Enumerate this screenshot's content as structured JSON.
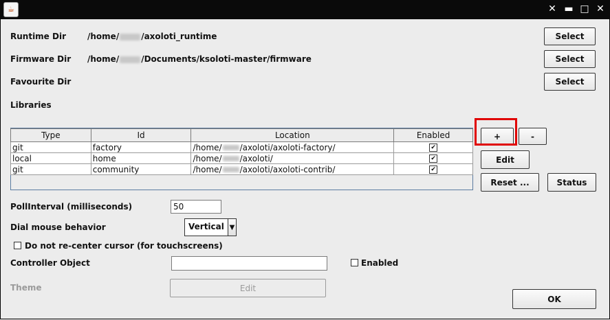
{
  "window": {
    "title": ""
  },
  "window_controls": {
    "close": "✕",
    "minimize": "▬",
    "maximize": "□",
    "restore": "✕"
  },
  "dirs": {
    "runtime": {
      "label": "Runtime Dir",
      "prefix": "/home/",
      "suffix": "/axoloti_runtime",
      "button": "Select"
    },
    "firmware": {
      "label": "Firmware Dir",
      "prefix": "/home/",
      "suffix": "/Documents/ksoloti-master/firmware",
      "button": "Select"
    },
    "favourite": {
      "label": "Favourite Dir",
      "button": "Select"
    }
  },
  "libraries": {
    "label": "Libraries",
    "columns": [
      "Type",
      "Id",
      "Location",
      "Enabled"
    ],
    "rows": [
      {
        "type": "git",
        "id": "factory",
        "loc_prefix": "/home/",
        "loc_suffix": "/axoloti/axoloti-factory/",
        "enabled": "✔"
      },
      {
        "type": "local",
        "id": "home",
        "loc_prefix": "/home/",
        "loc_suffix": "/axoloti/",
        "enabled": "✔"
      },
      {
        "type": "git",
        "id": "community",
        "loc_prefix": "/home/",
        "loc_suffix": "/axoloti/axoloti-contrib/",
        "enabled": "✔"
      }
    ],
    "buttons": {
      "add": "+",
      "remove": "-",
      "edit": "Edit",
      "reset": "Reset ...",
      "status": "Status"
    }
  },
  "poll": {
    "label": "PollInterval (milliseconds)",
    "value": "50"
  },
  "dial": {
    "label": "Dial mouse behavior",
    "selected": "Vertical",
    "arrow": "▼"
  },
  "recenter": {
    "label": "Do not re-center cursor (for touchscreens)"
  },
  "controller": {
    "label": "Controller Object",
    "value": "",
    "enabled_label": "Enabled"
  },
  "theme": {
    "label": "Theme",
    "button": "Edit"
  },
  "ok": "OK"
}
